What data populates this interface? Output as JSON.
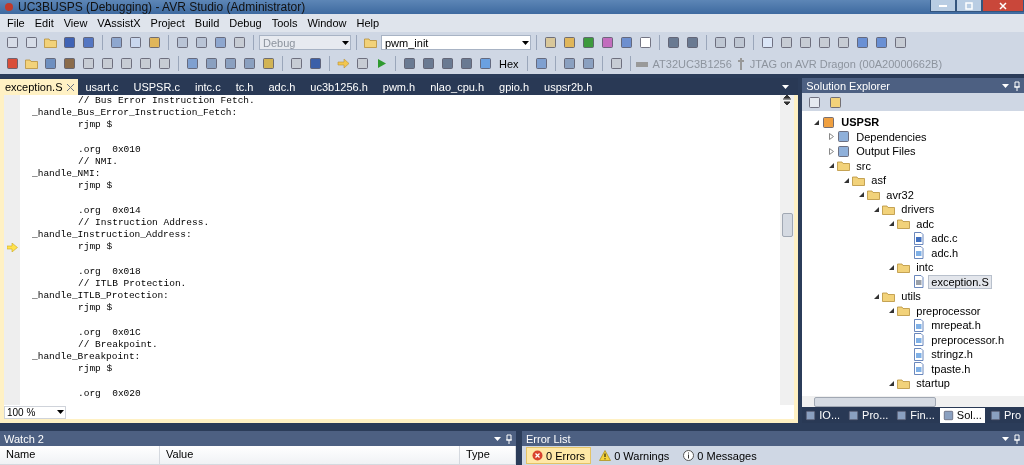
{
  "window": {
    "title": "UC3BUSPS (Debugging) - AVR Studio (Administrator)"
  },
  "menu": [
    "File",
    "Edit",
    "View",
    "VAssistX",
    "Project",
    "Build",
    "Debug",
    "Tools",
    "Window",
    "Help"
  ],
  "toolbar": {
    "configuration": {
      "value": "Debug",
      "disabled": true
    },
    "find_box": {
      "value": "pwm_init"
    },
    "hex_button": "Hex",
    "device": {
      "label": "AT32UC3B1256",
      "disabled": true
    },
    "tool": {
      "label": "JTAG on AVR Dragon (00A20000662B)",
      "disabled": true
    }
  },
  "document_tabs": [
    {
      "label": "exception.S",
      "selected": true
    },
    {
      "label": "usart.c",
      "selected": false
    },
    {
      "label": "USPSR.c",
      "selected": false
    },
    {
      "label": "intc.c",
      "selected": false
    },
    {
      "label": "tc.h",
      "selected": false
    },
    {
      "label": "adc.h",
      "selected": false
    },
    {
      "label": "uc3b1256.h",
      "selected": false
    },
    {
      "label": "pwm.h",
      "selected": false
    },
    {
      "label": "nlao_cpu.h",
      "selected": false
    },
    {
      "label": "gpio.h",
      "selected": false
    },
    {
      "label": "uspsr2b.h",
      "selected": false
    }
  ],
  "editor": {
    "lines": [
      {
        "kind": "statement",
        "text": "// Bus Error Instruction Fetch.",
        "current": false
      },
      {
        "kind": "label",
        "text": "_handle_Bus_Error_Instruction_Fetch:",
        "current": false
      },
      {
        "kind": "statement",
        "text": "rjmp $",
        "current": false
      },
      {
        "kind": "blank",
        "current": false
      },
      {
        "kind": "statement",
        "text": ".org  0x010",
        "current": false
      },
      {
        "kind": "statement",
        "text": "// NMI.",
        "current": false
      },
      {
        "kind": "label",
        "text": "_handle_NMI:",
        "current": false
      },
      {
        "kind": "statement",
        "text": "rjmp $",
        "current": false
      },
      {
        "kind": "blank",
        "current": false
      },
      {
        "kind": "statement",
        "text": ".org  0x014",
        "current": false
      },
      {
        "kind": "statement",
        "text": "// Instruction Address.",
        "current": false
      },
      {
        "kind": "label",
        "text": "_handle_Instruction_Address:",
        "current": false
      },
      {
        "kind": "statement",
        "text": "rjmp $",
        "current": true
      },
      {
        "kind": "blank",
        "current": false
      },
      {
        "kind": "statement",
        "text": ".org  0x018",
        "current": false
      },
      {
        "kind": "statement",
        "text": "// ITLB Protection.",
        "current": false
      },
      {
        "kind": "label",
        "text": "_handle_ITLB_Protection:",
        "current": false
      },
      {
        "kind": "statement",
        "text": "rjmp $",
        "current": false
      },
      {
        "kind": "blank",
        "current": false
      },
      {
        "kind": "statement",
        "text": ".org  0x01C",
        "current": false
      },
      {
        "kind": "statement",
        "text": "// Breakpoint.",
        "current": false
      },
      {
        "kind": "label",
        "text": "_handle_Breakpoint:",
        "current": false
      },
      {
        "kind": "statement",
        "text": "rjmp $",
        "current": false
      },
      {
        "kind": "blank",
        "current": false
      },
      {
        "kind": "statement",
        "text": ".org  0x020",
        "current": false
      }
    ],
    "zoom": "100 %"
  },
  "solution_explorer": {
    "title": "Solution Explorer",
    "tree": [
      {
        "kind": "project",
        "label": "USPSR",
        "expanded": true,
        "selected": false,
        "children": [
          {
            "kind": "reference",
            "label": "Dependencies",
            "expanded": false,
            "selected": false
          },
          {
            "kind": "reference",
            "label": "Output Files",
            "expanded": false,
            "selected": false
          },
          {
            "kind": "folder",
            "label": "src",
            "expanded": true,
            "selected": false,
            "children": [
              {
                "kind": "folder",
                "label": "asf",
                "expanded": true,
                "selected": false,
                "children": [
                  {
                    "kind": "folder",
                    "label": "avr32",
                    "expanded": true,
                    "selected": false,
                    "children": [
                      {
                        "kind": "folder",
                        "label": "drivers",
                        "expanded": true,
                        "selected": false,
                        "children": [
                          {
                            "kind": "folder",
                            "label": "adc",
                            "expanded": true,
                            "selected": false,
                            "children": [
                              {
                                "kind": "c",
                                "label": "adc.c",
                                "selected": false
                              },
                              {
                                "kind": "h",
                                "label": "adc.h",
                                "selected": false
                              }
                            ]
                          },
                          {
                            "kind": "folder",
                            "label": "intc",
                            "expanded": true,
                            "selected": false,
                            "children": [
                              {
                                "kind": "asm",
                                "label": "exception.S",
                                "selected": true
                              }
                            ]
                          }
                        ]
                      },
                      {
                        "kind": "folder",
                        "label": "utils",
                        "expanded": true,
                        "selected": false,
                        "children": [
                          {
                            "kind": "folder",
                            "label": "preprocessor",
                            "expanded": true,
                            "selected": false,
                            "children": [
                              {
                                "kind": "h",
                                "label": "mrepeat.h",
                                "selected": false
                              },
                              {
                                "kind": "h",
                                "label": "preprocessor.h",
                                "selected": false
                              },
                              {
                                "kind": "h",
                                "label": "stringz.h",
                                "selected": false
                              },
                              {
                                "kind": "h",
                                "label": "tpaste.h",
                                "selected": false
                              }
                            ]
                          },
                          {
                            "kind": "folder",
                            "label": "startup",
                            "expanded": true,
                            "selected": false
                          }
                        ]
                      }
                    ]
                  }
                ]
              }
            ]
          }
        ]
      }
    ],
    "bottom_tabs": [
      {
        "label": "IO...",
        "selected": false
      },
      {
        "label": "Pro...",
        "selected": false
      },
      {
        "label": "Fin...",
        "selected": false
      },
      {
        "label": "Sol...",
        "selected": true
      },
      {
        "label": "Pro",
        "selected": false
      }
    ]
  },
  "watch": {
    "title": "Watch 2",
    "columns": [
      "Name",
      "Value",
      "Type"
    ]
  },
  "error_list": {
    "title": "Error List",
    "filters": [
      {
        "kind": "error",
        "label": "0 Errors",
        "selected": true
      },
      {
        "kind": "warning",
        "label": "0 Warnings",
        "selected": false
      },
      {
        "kind": "message",
        "label": "0 Messages",
        "selected": false
      }
    ]
  }
}
